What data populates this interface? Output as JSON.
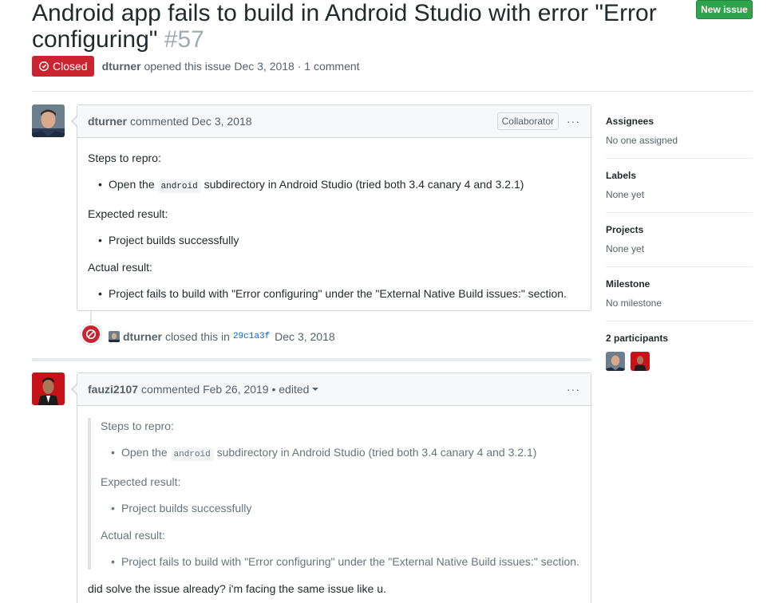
{
  "issue": {
    "title": "Android app fails to build in Android Studio with error \"Error configuring\"",
    "number": "#57",
    "new_issue_label": "New issue",
    "state_label": "Closed",
    "author": "dturner",
    "opened_text": "opened this issue Dec 3, 2018 · 1 comment"
  },
  "comment1": {
    "author": "dturner",
    "header_text": "commented Dec 3, 2018",
    "badge": "Collaborator",
    "menu": "···",
    "steps_label": "Steps to repro:",
    "step_prefix": "Open the",
    "step_code": "android",
    "step_suffix": "subdirectory in Android Studio (tried both 3.4 canary 4 and 3.2.1)",
    "expected_label": "Expected result:",
    "expected_item": "Project builds successfully",
    "actual_label": "Actual result:",
    "actual_item": "Project fails to build with \"Error configuring\" under the \"External Native Build issues:\" section."
  },
  "event": {
    "actor": "dturner",
    "action": "closed this in",
    "sha": "29c1a3f",
    "date": "Dec 3, 2018"
  },
  "comment2": {
    "author": "fauzi2107",
    "header_text": "commented Feb 26, 2019 • edited",
    "menu": "···",
    "steps_label": "Steps to repro:",
    "step_prefix": "Open the",
    "step_code": "android",
    "step_suffix": "subdirectory in Android Studio (tried both 3.4 canary 4 and 3.2.1)",
    "expected_label": "Expected result:",
    "expected_item": "Project builds successfully",
    "actual_label": "Actual result:",
    "actual_item": "Project fails to build with \"Error configuring\" under the \"External Native Build issues:\" section.",
    "reply": "did solve the issue already? i'm facing the same issue like u."
  },
  "sidebar": {
    "assignees_label": "Assignees",
    "assignees_value": "No one assigned",
    "labels_label": "Labels",
    "labels_value": "None yet",
    "projects_label": "Projects",
    "projects_value": "None yet",
    "milestone_label": "Milestone",
    "milestone_value": "No milestone",
    "participants_label": "2 participants"
  },
  "colors": {
    "closed_red": "#cb2431",
    "new_issue_green": "#2ea44f",
    "link_blue": "#0366d6"
  }
}
